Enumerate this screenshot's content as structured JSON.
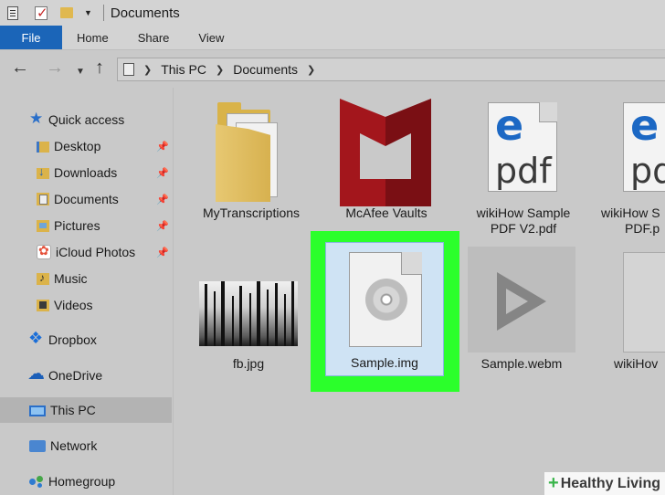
{
  "window": {
    "title": "Documents"
  },
  "ribbon": {
    "tabs": [
      "File",
      "Home",
      "Share",
      "View"
    ],
    "active_tab": "File",
    "accent_color": "#1b65b8"
  },
  "address": {
    "crumbs": [
      "This PC",
      "Documents"
    ]
  },
  "sidebar": {
    "items": [
      {
        "label": "Quick access",
        "icon": "star-icon",
        "pinned": false
      },
      {
        "label": "Desktop",
        "icon": "desktop-folder-icon",
        "pinned": true
      },
      {
        "label": "Downloads",
        "icon": "downloads-folder-icon",
        "pinned": true
      },
      {
        "label": "Documents",
        "icon": "documents-folder-icon",
        "pinned": true
      },
      {
        "label": "Pictures",
        "icon": "pictures-folder-icon",
        "pinned": true
      },
      {
        "label": "iCloud Photos",
        "icon": "icloud-photos-icon",
        "pinned": true
      },
      {
        "label": "Music",
        "icon": "music-folder-icon",
        "pinned": false
      },
      {
        "label": "Videos",
        "icon": "videos-folder-icon",
        "pinned": false
      },
      {
        "label": "Dropbox",
        "icon": "dropbox-icon",
        "pinned": false
      },
      {
        "label": "OneDrive",
        "icon": "onedrive-icon",
        "pinned": false
      },
      {
        "label": "This PC",
        "icon": "computer-icon",
        "pinned": false,
        "selected": true
      },
      {
        "label": "Network",
        "icon": "network-icon",
        "pinned": false
      },
      {
        "label": "Homegroup",
        "icon": "homegroup-icon",
        "pinned": false
      }
    ]
  },
  "files": {
    "row1": [
      {
        "line1": "MyTranscriptions",
        "line2": "",
        "icon": "folder-icon"
      },
      {
        "line1": "McAfee Vaults",
        "line2": "",
        "icon": "mcafee-icon"
      },
      {
        "line1": "wikiHow Sample",
        "line2": "PDF V2.pdf",
        "icon": "edge-pdf-icon"
      },
      {
        "line1": "wikiHow S",
        "line2": "PDF.p",
        "icon": "edge-pdf-icon"
      }
    ],
    "row2": [
      {
        "line1": "fb.jpg",
        "icon": "photo-thumbnail"
      },
      {
        "line1": "Sample.img",
        "icon": "disc-image-icon",
        "selected": true
      },
      {
        "line1": "Sample.webm",
        "icon": "video-thumbnail"
      },
      {
        "line1": "wikiHov",
        "icon": "file-thumbnail"
      }
    ],
    "pdf_word": "pdf",
    "edge_letter": "e",
    "highlight_color": "#2bff2b"
  },
  "watermark": {
    "plus": "+",
    "text": "Healthy Living"
  }
}
